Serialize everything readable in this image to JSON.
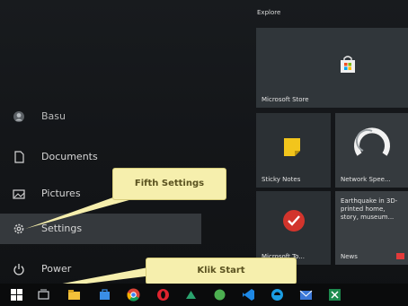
{
  "start_menu": {
    "nav": {
      "user_label": "Basu",
      "documents_label": "Documents",
      "pictures_label": "Pictures",
      "settings_label": "Settings",
      "power_label": "Power"
    },
    "tile_group_title": "Explore",
    "tiles": {
      "store": "Microsoft Store",
      "sticky": "Sticky Notes",
      "netspeed": "Network Spee...",
      "todo": "Microsoft To...",
      "news": "News",
      "news_headline": "Earthquake in 3D-printed home, story, museum..."
    }
  },
  "callouts": {
    "settings": "Fifth Settings",
    "start": "Klik Start"
  },
  "taskbar": {
    "icons": [
      "start-icon",
      "task-view-icon",
      "file-explorer-icon",
      "store-icon",
      "chrome-icon",
      "opera-icon",
      "app-icon",
      "green-app-icon",
      "vscode-icon",
      "edge-icon",
      "mail-icon",
      "excel-icon"
    ]
  },
  "colors": {
    "callout_fill": "#f6efad",
    "settings_highlight": "#35393d",
    "sticky_yellow": "#f2c51c",
    "todo_red": "#d2342c",
    "news_red": "#e23a3a"
  }
}
